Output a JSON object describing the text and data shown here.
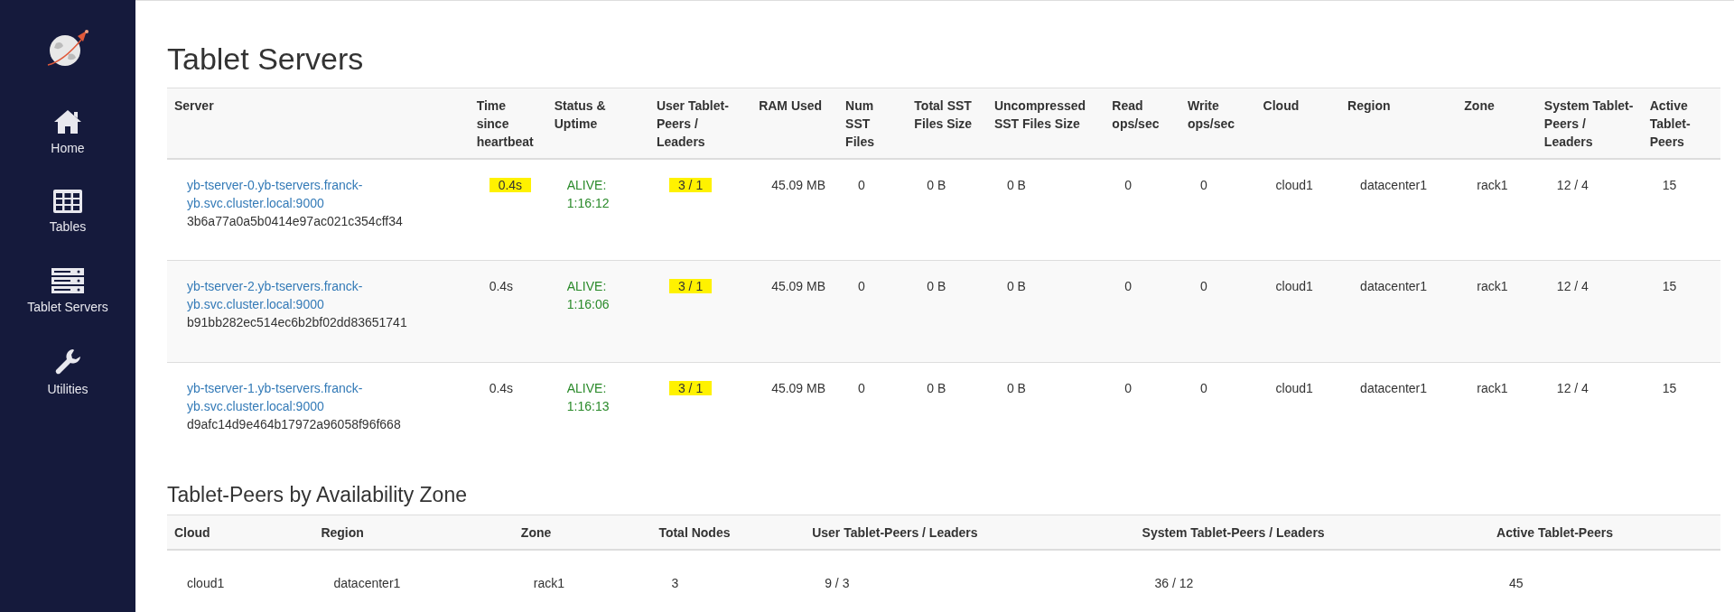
{
  "sidebar": {
    "items": [
      {
        "label": "Home",
        "kind": "home"
      },
      {
        "label": "Tables",
        "kind": "table"
      },
      {
        "label": "Tablet Servers",
        "kind": "servers"
      },
      {
        "label": "Utilities",
        "kind": "wrench"
      }
    ]
  },
  "servers": {
    "title": "Tablet Servers",
    "columns": [
      "Server",
      "Time since heartbeat",
      "Status & Uptime",
      "User Tablet-Peers / Leaders",
      "RAM Used",
      "Num SST Files",
      "Total SST Files Size",
      "Uncompressed SST Files Size",
      "Read ops/sec",
      "Write ops/sec",
      "Cloud",
      "Region",
      "Zone",
      "System Tablet-Peers / Leaders",
      "Active Tablet-Peers"
    ],
    "rows": [
      {
        "server": "yb-tserver-0.yb-tservers.franck-yb.svc.cluster.local:9000",
        "uuid": "3b6a77a0a5b0414e97ac021c354cff34",
        "heartbeat": {
          "text": "0.4s",
          "highlighted": true
        },
        "status": "ALIVE: 1:16:12",
        "user_peers": {
          "text": "3 / 1",
          "highlighted": true
        },
        "ram": "45.09 MB",
        "num_sst": "0",
        "total_sst": "0 B",
        "uncompressed_sst": "0 B",
        "read_ops": "0",
        "write_ops": "0",
        "cloud": "cloud1",
        "region": "datacenter1",
        "zone": "rack1",
        "system_peers": "12 / 4",
        "active_peers": "15"
      },
      {
        "server": "yb-tserver-2.yb-tservers.franck-yb.svc.cluster.local:9000",
        "uuid": "b91bb282ec514ec6b2bf02dd83651741",
        "heartbeat": {
          "text": "0.4s",
          "highlighted": false
        },
        "status": "ALIVE: 1:16:06",
        "user_peers": {
          "text": "3 / 1",
          "highlighted": true
        },
        "ram": "45.09 MB",
        "num_sst": "0",
        "total_sst": "0 B",
        "uncompressed_sst": "0 B",
        "read_ops": "0",
        "write_ops": "0",
        "cloud": "cloud1",
        "region": "datacenter1",
        "zone": "rack1",
        "system_peers": "12 / 4",
        "active_peers": "15"
      },
      {
        "server": "yb-tserver-1.yb-tservers.franck-yb.svc.cluster.local:9000",
        "uuid": "d9afc14d9e464b17972a96058f96f668",
        "heartbeat": {
          "text": "0.4s",
          "highlighted": false
        },
        "status": "ALIVE: 1:16:13",
        "user_peers": {
          "text": "3 / 1",
          "highlighted": true
        },
        "ram": "45.09 MB",
        "num_sst": "0",
        "total_sst": "0 B",
        "uncompressed_sst": "0 B",
        "read_ops": "0",
        "write_ops": "0",
        "cloud": "cloud1",
        "region": "datacenter1",
        "zone": "rack1",
        "system_peers": "12 / 4",
        "active_peers": "15"
      }
    ]
  },
  "zones": {
    "title": "Tablet-Peers by Availability Zone",
    "columns": [
      "Cloud",
      "Region",
      "Zone",
      "Total Nodes",
      "User Tablet-Peers / Leaders",
      "System Tablet-Peers / Leaders",
      "Active Tablet-Peers"
    ],
    "rows": [
      [
        "cloud1",
        "datacenter1",
        "rack1",
        "3",
        "9 / 3",
        "36 / 12",
        "45"
      ]
    ]
  }
}
